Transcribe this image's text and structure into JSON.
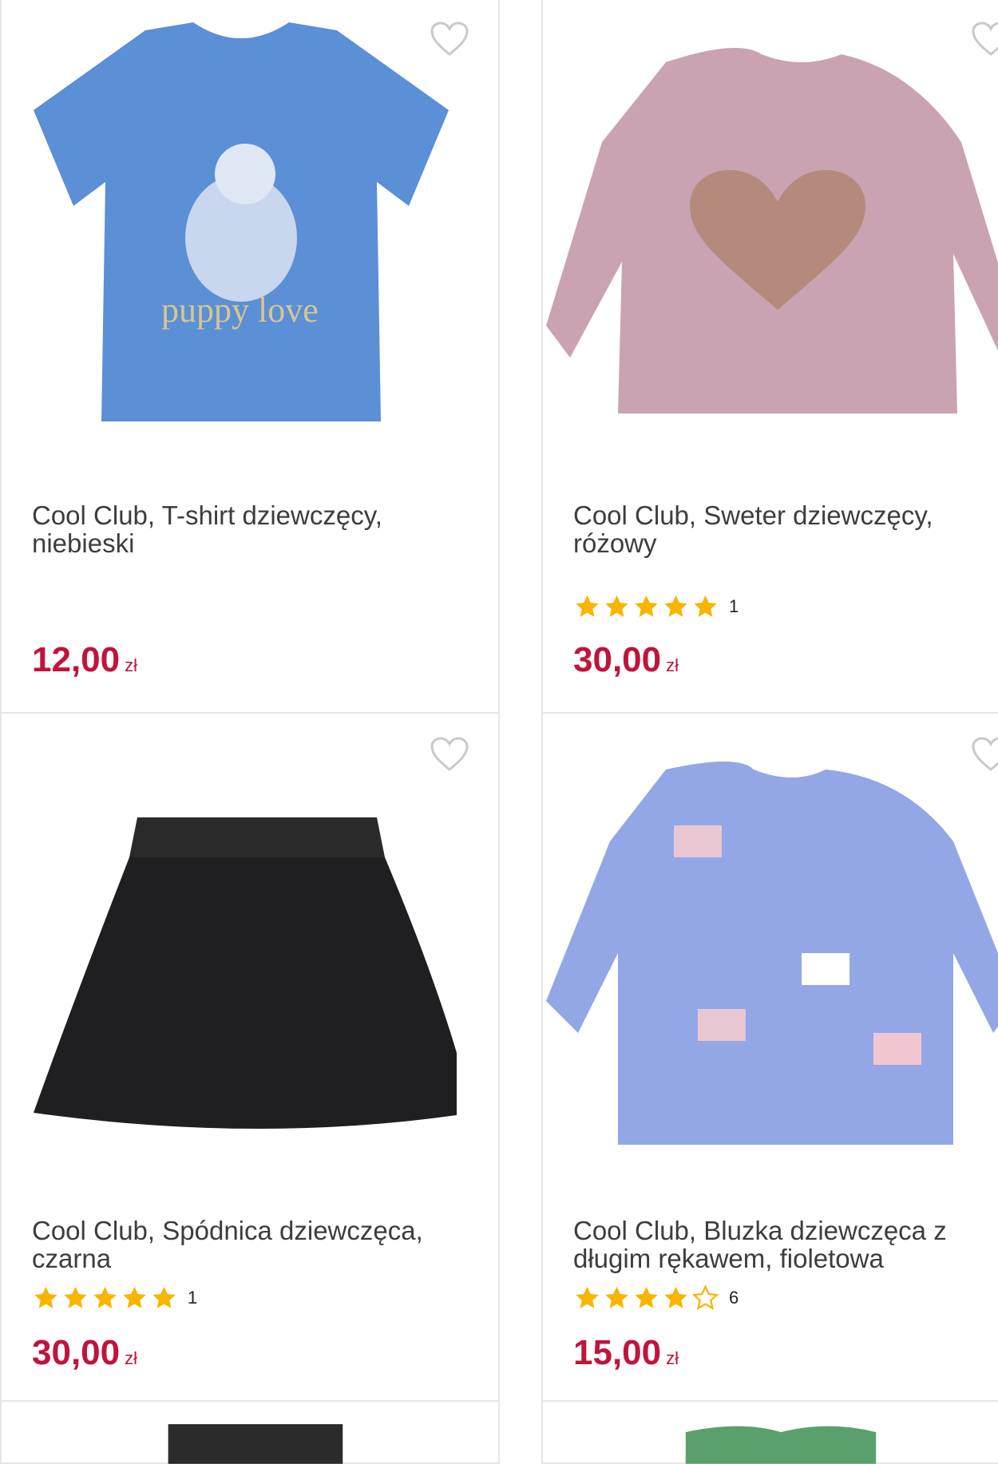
{
  "products": [
    {
      "title": "Cool Club, T-shirt dziewczęcy, niebieski",
      "price": "12,00",
      "currency": "zł",
      "rating": null,
      "reviews": ""
    },
    {
      "title": "Cool Club, Sweter dziewczęcy, różowy",
      "price": "30,00",
      "currency": "zł",
      "rating": 5,
      "reviews": "1"
    },
    {
      "title": "Cool Club, Spódnica dziewczęca, czarna",
      "price": "30,00",
      "currency": "zł",
      "rating": 5,
      "reviews": "1"
    },
    {
      "title": "Cool Club, Bluzka dziewczęca z długim rękawem, fioletowa",
      "price": "15,00",
      "currency": "zł",
      "rating": 4,
      "reviews": "6"
    }
  ],
  "colors": {
    "price": "#c0143c",
    "star": "#f7b500",
    "border": "#e6e6e6"
  },
  "icons": {
    "favorite": "heart-outline-icon",
    "rating": "star-icon"
  }
}
